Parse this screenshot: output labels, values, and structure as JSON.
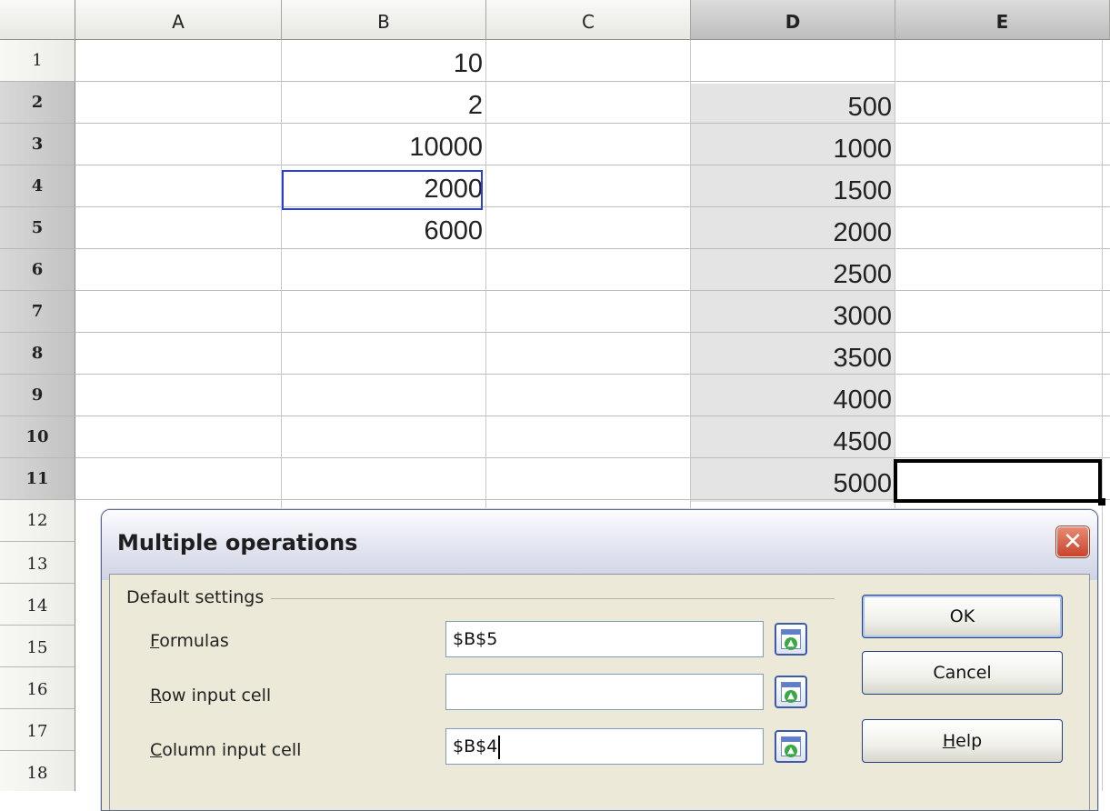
{
  "sheet": {
    "columns": [
      "A",
      "B",
      "C",
      "D",
      "E"
    ],
    "rows": [
      "1",
      "2",
      "3",
      "4",
      "5",
      "6",
      "7",
      "8",
      "9",
      "10",
      "11",
      "12",
      "13",
      "14",
      "15",
      "16",
      "17",
      "18"
    ],
    "columnB": [
      "10",
      "2",
      "10000",
      "2000",
      "6000"
    ],
    "columnD": [
      "",
      "500",
      "1000",
      "1500",
      "2000",
      "2500",
      "3000",
      "3500",
      "4000",
      "4500",
      "5000"
    ]
  },
  "dialog": {
    "title": "Multiple operations",
    "group_label": "Default settings",
    "fields": [
      {
        "label_underlined": "F",
        "label_rest": "ormulas",
        "value": "$B$5"
      },
      {
        "label_underlined": "R",
        "label_rest": "ow input cell",
        "value": ""
      },
      {
        "label_underlined": "C",
        "label_rest": "olumn input cell",
        "value": "$B$4"
      }
    ],
    "buttons": {
      "ok": "OK",
      "cancel": "Cancel",
      "help_underlined": "H",
      "help_rest": "elp"
    },
    "close_glyph": "✕"
  }
}
